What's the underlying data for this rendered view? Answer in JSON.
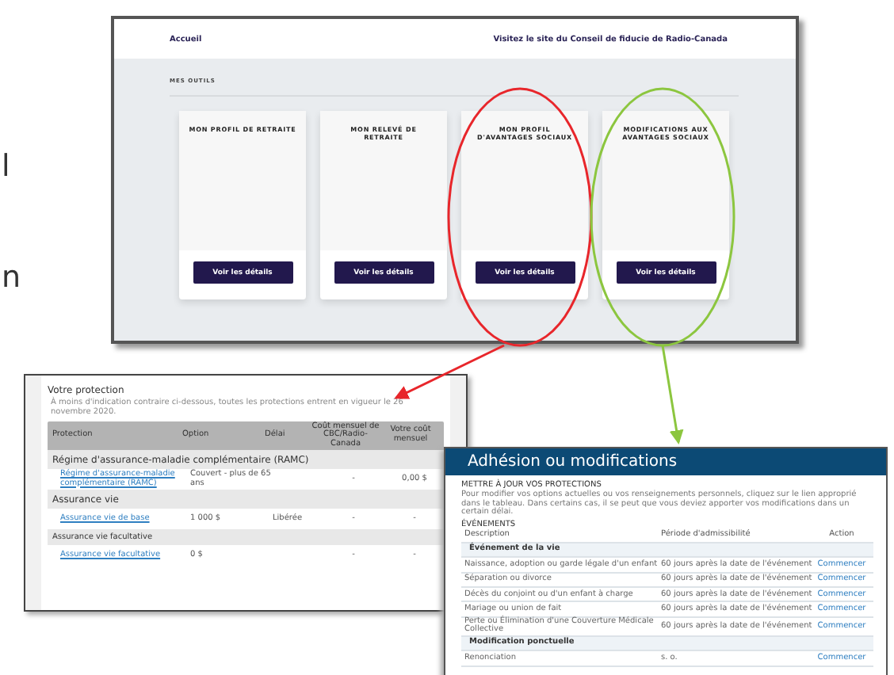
{
  "side_text": [
    "l",
    "n"
  ],
  "portal": {
    "nav": {
      "home": "Accueil",
      "link": "Visitez le site du Conseil de fiducie de Radio-Canada"
    },
    "section_title": "MES OUTILS",
    "tools": [
      {
        "title": "MON PROFIL DE RETRAITE",
        "button": "Voir les détails"
      },
      {
        "title": "MON RELEVÉ DE RETRAITE",
        "button": "Voir les détails"
      },
      {
        "title": "MON PROFIL D'AVANTAGES SOCIAUX",
        "button": "Voir les détails",
        "color": "#e8262b"
      },
      {
        "title": "MODIFICATIONS AUX AVANTAGES SOCIAUX",
        "button": "Voir les détails",
        "color": "#8cc63f"
      }
    ]
  },
  "protection": {
    "title": "Votre protection",
    "note": "À moins d'indication contraire ci-dessous, toutes les protections entrent en vigueur le 26 novembre 2020.",
    "columns": [
      "Protection",
      "Option",
      "Délai",
      "Coût mensuel de CBC/Radio-Canada",
      "Votre coût mensuel"
    ],
    "rows": [
      {
        "kind": "group",
        "label": "Régime d'assurance-maladie complémentaire (RAMC)"
      },
      {
        "kind": "item",
        "cells": [
          "Régime d'assurance-maladie complémentaire (RAMC)",
          "Couvert - plus de 65 ans",
          "",
          "-",
          "0,00 $"
        ]
      },
      {
        "kind": "group",
        "label": "Assurance vie"
      },
      {
        "kind": "item",
        "cells": [
          "Assurance vie de base",
          "1 000 $",
          "Libérée",
          "-",
          "-"
        ]
      },
      {
        "kind": "subgroup",
        "label": "Assurance vie facultative"
      },
      {
        "kind": "item",
        "cells": [
          "Assurance vie facultative",
          "0 $",
          "",
          "-",
          "-"
        ]
      }
    ]
  },
  "enrolment": {
    "title": "Adhésion ou modifications",
    "section": "METTRE À JOUR VOS PROTECTIONS",
    "intro": "Pour modifier vos options actuelles ou vos renseignements personnels, cliquez sur le lien approprié dans le tableau. Dans certains cas, il se peut que vous deviez apporter vos modifications dans un certain délai.",
    "events_title": "ÉVÉNEMENTS",
    "columns": [
      "Description",
      "Période d'admissibilité",
      "Action"
    ],
    "rows": [
      {
        "kind": "group",
        "label": "Événement de la vie"
      },
      {
        "kind": "item",
        "cells": [
          "Naissance, adoption ou garde légale d'un enfant",
          "60 jours après la date de l'événement",
          "Commencer"
        ]
      },
      {
        "kind": "item",
        "cells": [
          "Séparation ou divorce",
          "60 jours après la date de l'événement",
          "Commencer"
        ]
      },
      {
        "kind": "item",
        "cells": [
          "Décès du conjoint ou d'un enfant à charge",
          "60 jours après la date de l'événement",
          "Commencer"
        ]
      },
      {
        "kind": "item",
        "cells": [
          "Mariage ou union de fait",
          "60 jours après la date de l'événement",
          "Commencer"
        ]
      },
      {
        "kind": "item",
        "cells": [
          "Perte ou Élimination d'une Couverture Médicale Collective",
          "60 jours après la date de l'événement",
          "Commencer"
        ]
      },
      {
        "kind": "group",
        "label": "Modification ponctuelle"
      },
      {
        "kind": "item",
        "cells": [
          "Renonciation",
          "s. o.",
          "Commencer"
        ]
      }
    ]
  }
}
